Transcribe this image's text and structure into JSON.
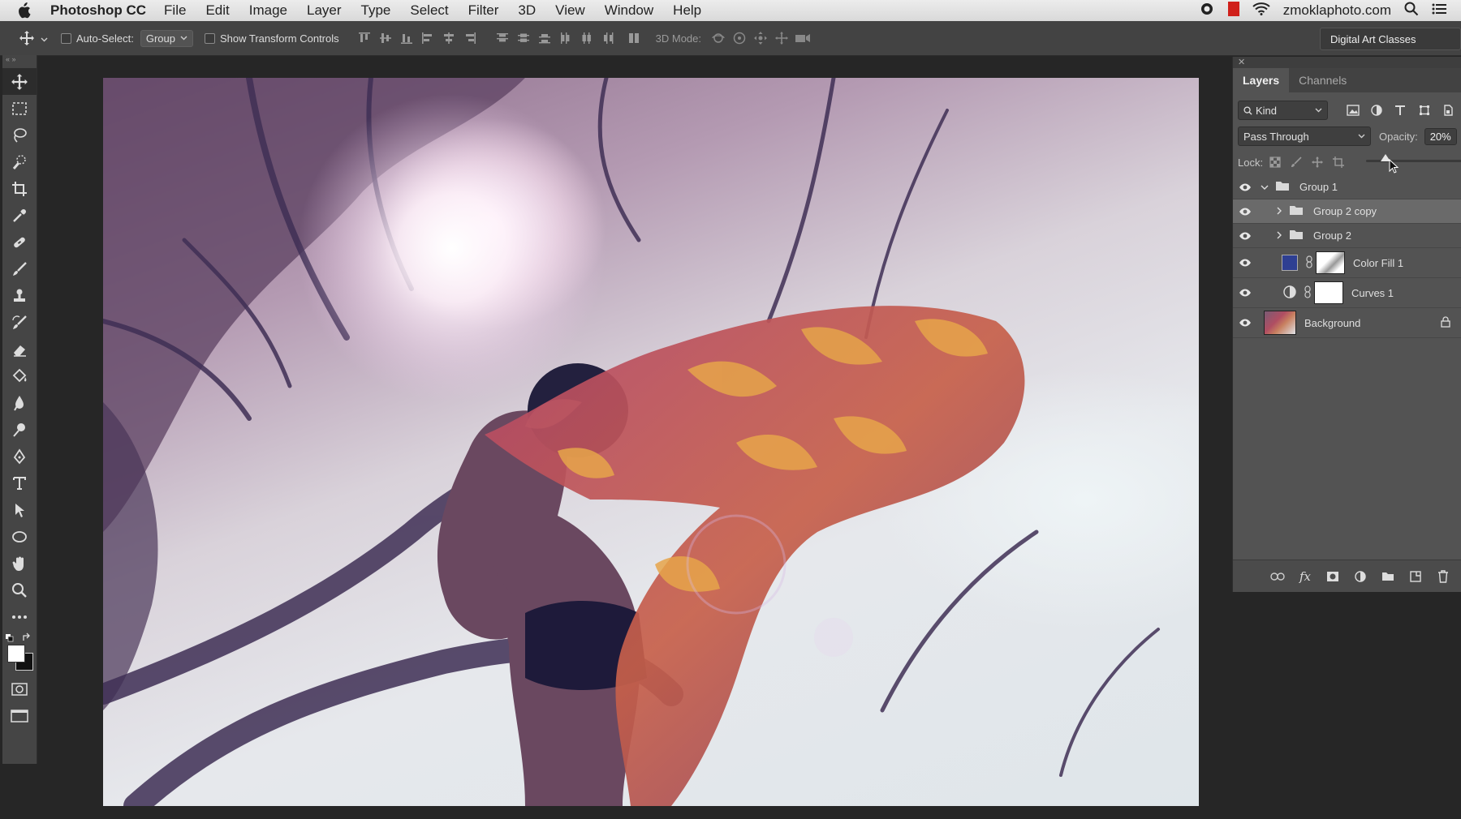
{
  "menubar": {
    "app_name": "Photoshop CC",
    "menus": [
      "File",
      "Edit",
      "Image",
      "Layer",
      "Type",
      "Select",
      "Filter",
      "3D",
      "View",
      "Window",
      "Help"
    ],
    "site": "zmoklaphoto.com"
  },
  "options_bar": {
    "auto_select_label": "Auto-Select:",
    "auto_select_value": "Group",
    "show_transform_label": "Show Transform Controls",
    "mode_3d_label": "3D Mode:",
    "workspace": "Digital Art Classes"
  },
  "layers_panel": {
    "tabs": [
      "Layers",
      "Channels"
    ],
    "filter_kind": "Kind",
    "blend_mode": "Pass Through",
    "opacity_label": "Opacity:",
    "opacity_value": "20%",
    "opacity_fraction": 0.2,
    "lock_label": "Lock:",
    "layers": [
      {
        "name": "Group 1",
        "type": "group",
        "expanded": true,
        "visible": true
      },
      {
        "name": "Group 2 copy",
        "type": "group",
        "expanded": false,
        "visible": true,
        "selected": true
      },
      {
        "name": "Group 2",
        "type": "group",
        "expanded": false,
        "visible": true
      },
      {
        "name": "Color Fill 1",
        "type": "fill",
        "visible": true,
        "fill_color": "#2e3f92"
      },
      {
        "name": "Curves 1",
        "type": "adjustment",
        "visible": true
      },
      {
        "name": "Background",
        "type": "image",
        "visible": true,
        "locked": true
      }
    ]
  },
  "colors": {
    "foreground": "#ffffff",
    "background": "#111111"
  }
}
